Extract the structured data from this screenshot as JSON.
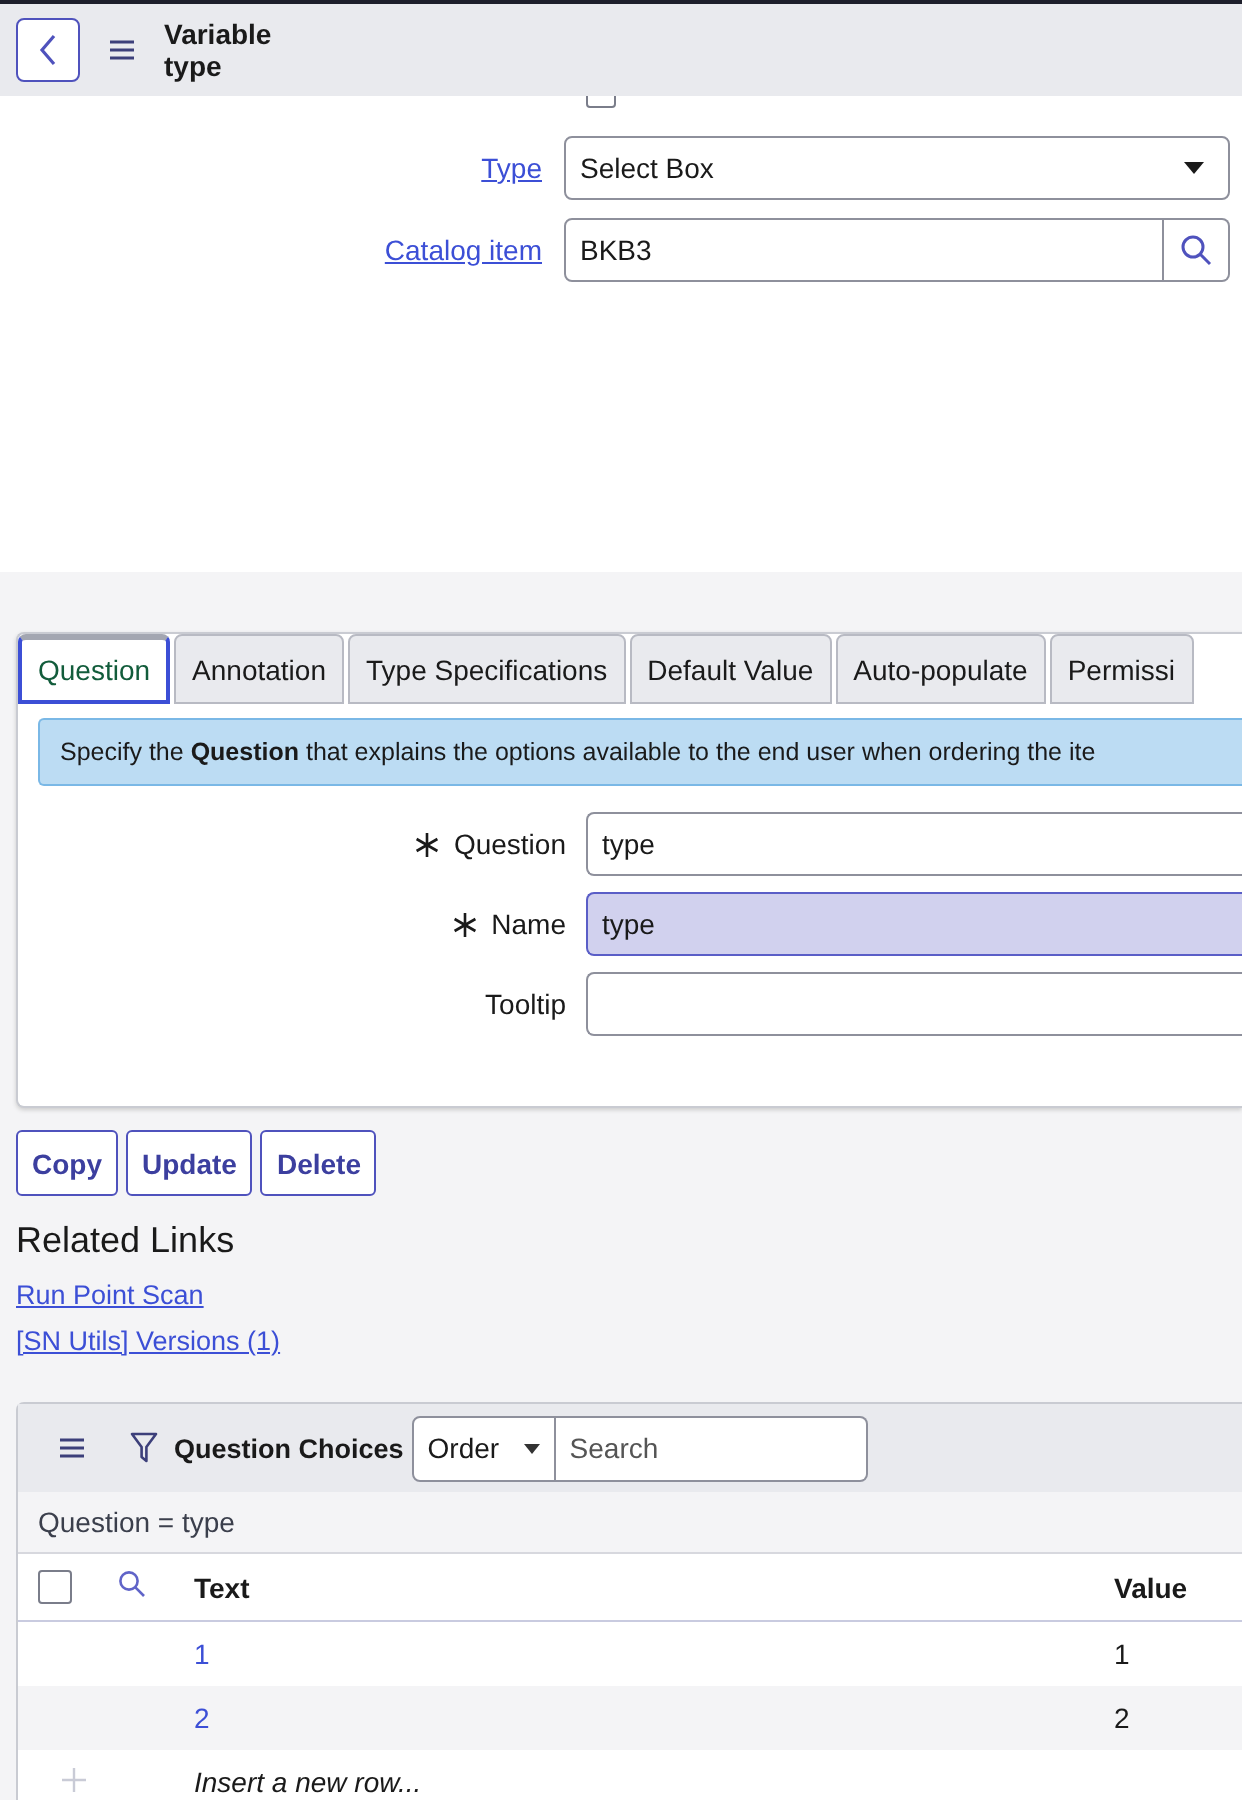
{
  "header": {
    "title": "Variable type"
  },
  "top_checkbox": {
    "checked": false
  },
  "fields": [
    {
      "label": "Type",
      "kind": "select",
      "value": "Select Box"
    },
    {
      "label": "Catalog item",
      "kind": "reference",
      "value": "BKB3"
    }
  ],
  "tabs": [
    {
      "label": "Question",
      "selected": true
    },
    {
      "label": "Annotation",
      "selected": false
    },
    {
      "label": "Type Specifications",
      "selected": false
    },
    {
      "label": "Default Value",
      "selected": false
    },
    {
      "label": "Auto-populate",
      "selected": false
    },
    {
      "label": "Permissi",
      "selected": false
    }
  ],
  "info": "Specify the **Question** that explains the options available to the end user when ordering the ite",
  "question_fields": [
    {
      "label": "Question",
      "required": true,
      "value": "type",
      "readonly": false
    },
    {
      "label": "Name",
      "required": true,
      "value": "type",
      "readonly": true
    },
    {
      "label": "Tooltip",
      "required": false,
      "readonly": false
    }
  ],
  "buttons": [
    "Copy",
    "Update",
    "Delete"
  ],
  "related_links": {
    "title": "Related Links",
    "links": [
      "Run Point Scan",
      "[SN Utils] Versions (1)"
    ]
  },
  "list": {
    "title": "Question Choices",
    "sort_field": "Order",
    "search_placeholder": "Search",
    "filter": "Question = type",
    "select_all": {
      "checked": false
    },
    "columns": [
      "Text",
      "Value"
    ],
    "rows": [
      {
        "text": "1",
        "value": "1"
      },
      {
        "text": "2",
        "value": "2"
      }
    ],
    "insert_row": "Insert a new row..."
  }
}
